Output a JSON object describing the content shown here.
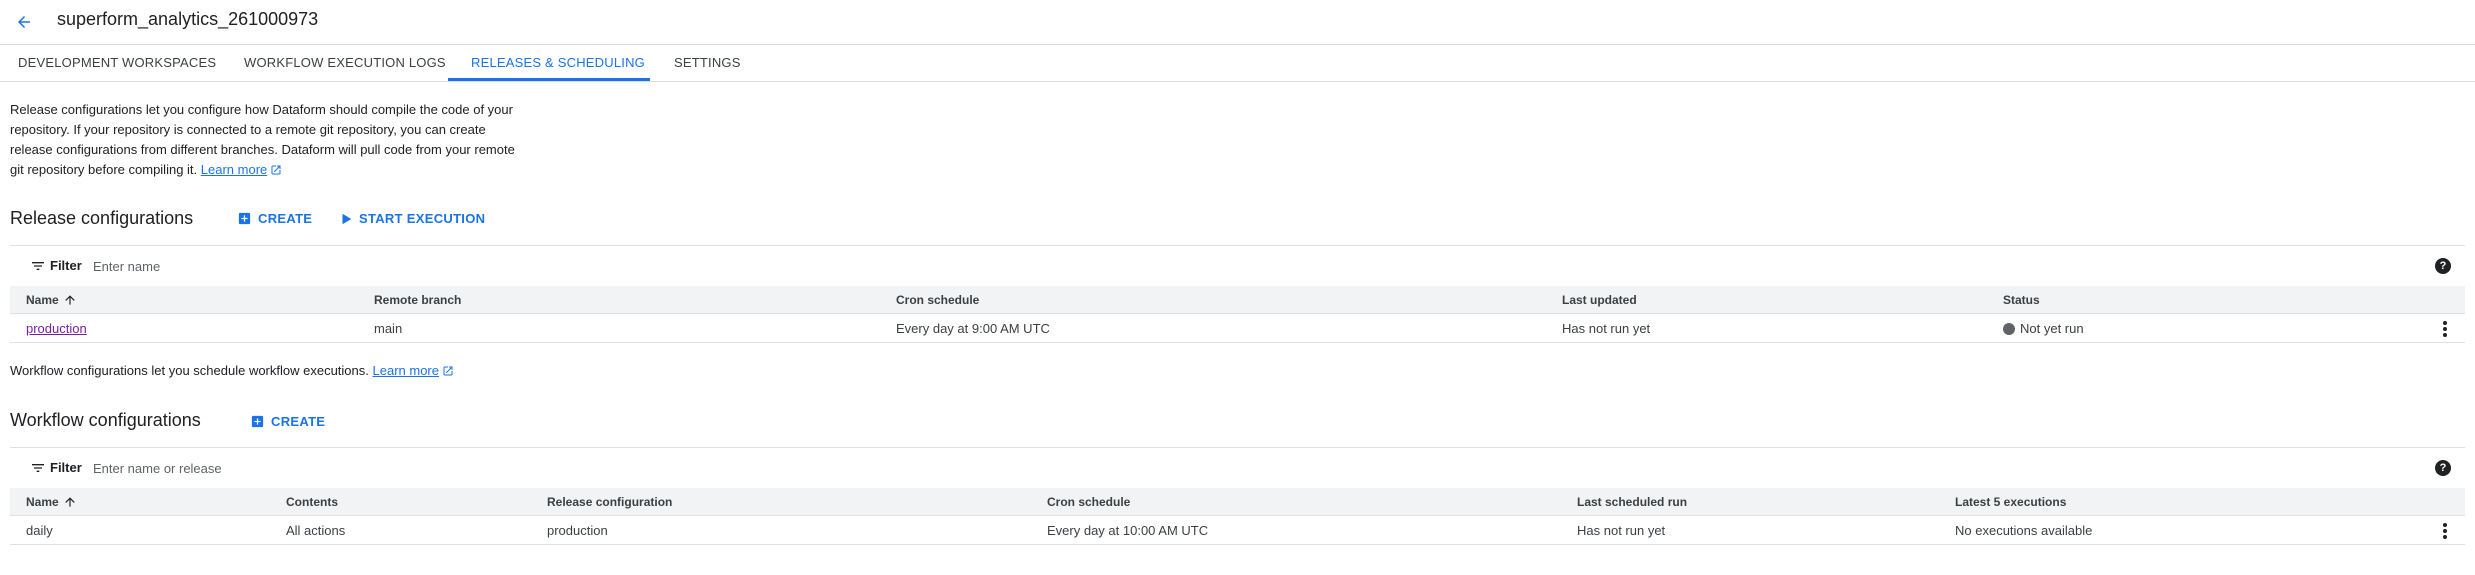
{
  "header": {
    "title": "superform_analytics_261000973",
    "back_icon": "arrow-back-icon"
  },
  "tabs": [
    {
      "label": "DEVELOPMENT WORKSPACES",
      "active": false
    },
    {
      "label": "WORKFLOW EXECUTION LOGS",
      "active": false
    },
    {
      "label": "RELEASES & SCHEDULING",
      "active": true
    },
    {
      "label": "SETTINGS",
      "active": false
    }
  ],
  "release_section": {
    "description": "Release configurations let you configure how Dataform should compile the code of your repository. If your repository is connected to a remote git repository, you can create release configurations from different branches. Dataform will pull code from your remote git repository before compiling it.",
    "learn_more": "Learn more",
    "title": "Release configurations",
    "create_label": "CREATE",
    "start_execution_label": "START EXECUTION",
    "filter": {
      "label": "Filter",
      "placeholder": "Enter name"
    },
    "columns": [
      "Name",
      "Remote branch",
      "Cron schedule",
      "Last updated",
      "Status"
    ],
    "rows": [
      {
        "name": "production",
        "remote_branch": "main",
        "cron_schedule": "Every day at 9:00 AM UTC",
        "last_updated": "Has not run yet",
        "status": "Not yet run"
      }
    ]
  },
  "workflow_section": {
    "description": "Workflow configurations let you schedule workflow executions.",
    "learn_more": "Learn more",
    "title": "Workflow configurations",
    "create_label": "CREATE",
    "filter": {
      "label": "Filter",
      "placeholder": "Enter name or release"
    },
    "columns": [
      "Name",
      "Contents",
      "Release configuration",
      "Cron schedule",
      "Last scheduled run",
      "Latest 5 executions"
    ],
    "rows": [
      {
        "name": "daily",
        "contents": "All actions",
        "release_configuration": "production",
        "cron_schedule": "Every day at 10:00 AM UTC",
        "last_scheduled_run": "Has not run yet",
        "latest_executions": "No executions available"
      }
    ]
  },
  "colors": {
    "accent": "#1a73e8",
    "link_visited": "#7b1fa2",
    "status_grey": "#5f6368"
  }
}
